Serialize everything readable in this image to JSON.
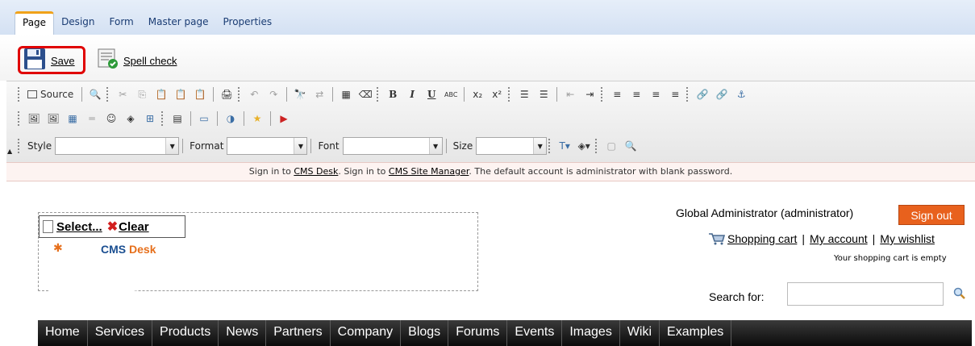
{
  "tabs": [
    "Page",
    "Design",
    "Form",
    "Master page",
    "Properties"
  ],
  "actions": {
    "save": "Save",
    "spell_check": "Spell check"
  },
  "toolbar": {
    "source": "Source",
    "style_label": "Style",
    "format_label": "Format",
    "font_label": "Font",
    "size_label": "Size",
    "style_value": "",
    "format_value": "",
    "font_value": "",
    "size_value": ""
  },
  "info": {
    "prefix": "Sign in to",
    "cms_desk": "CMS Desk",
    "mid": ". Sign in to",
    "site_manager": "CMS Site Manager",
    "suffix": ". The default account is administrator with blank password."
  },
  "logo_selector": {
    "select": "Select...",
    "clear": "Clear"
  },
  "logo": {
    "cms": "CMS",
    "desk": "Desk"
  },
  "header": {
    "user": "Global Administrator (administrator)",
    "sign_out": "Sign out",
    "shopping_cart": "Shopping cart",
    "my_account": "My account",
    "my_wishlist": "My wishlist",
    "cart_note": "Your shopping cart is empty",
    "search_label": "Search for:",
    "search_value": ""
  },
  "menu": [
    "Home",
    "Services",
    "Products",
    "News",
    "Partners",
    "Company",
    "Blogs",
    "Forums",
    "Events",
    "Images",
    "Wiki",
    "Examples"
  ],
  "colors": {
    "sign_out_bg": "#e8611d",
    "tab_accent": "#f0a21a",
    "save_highlight": "#e00000"
  }
}
